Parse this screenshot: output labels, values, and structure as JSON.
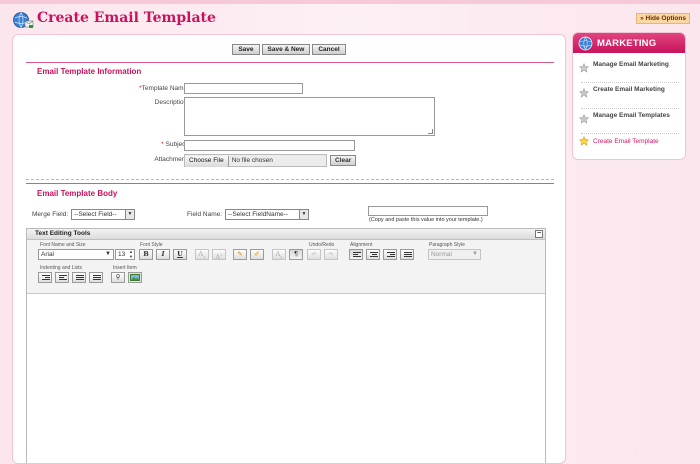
{
  "header": {
    "title": "Create Email Template",
    "hide_options": "» Hide Options"
  },
  "toolbar": {
    "save": "Save",
    "save_new": "Save & New",
    "cancel": "Cancel"
  },
  "info_section": {
    "title": "Email Template Information",
    "template_name_label": "Template Name:",
    "template_name_value": "",
    "description_label": "Description:",
    "subject_label": "Subject:",
    "subject_value": "",
    "attachment_label": "Attachment:",
    "choose_file": "Choose File",
    "no_file": "No file chosen",
    "clear": "Clear"
  },
  "body_section": {
    "title": "Email Template Body",
    "merge_field_label": "Merge Field:",
    "merge_field_value": "--Select Field--",
    "field_name_label": "Field Name:",
    "field_name_value": "--Select FieldName--",
    "copy_hint": "(Copy and paste this value into your template.)"
  },
  "editor": {
    "title": "Text Editing Tools",
    "font_name_size_label": "Font Name and Size",
    "font_name": "Arial",
    "font_size": "13",
    "font_style_label": "Font Style",
    "undo_redo_label": "Undo/Redo",
    "alignment_label": "Alignment",
    "paragraph_style_label": "Paragraph Style",
    "paragraph_style_value": "Normal",
    "indenting_label": "Indenting and Lists",
    "insert_label": "Insert Item",
    "bold": "B",
    "italic": "I",
    "underline": "U",
    "pilcrow": "¶"
  },
  "sidebar": {
    "title": "MARKETING",
    "items": [
      {
        "label": "Manage Email Marketing"
      },
      {
        "label": "Create Email Marketing"
      },
      {
        "label": "Manage Email Templates"
      },
      {
        "label": "Create Email Template"
      }
    ]
  },
  "colors": {
    "accent": "#c8125c",
    "background": "#fbe6ee"
  }
}
